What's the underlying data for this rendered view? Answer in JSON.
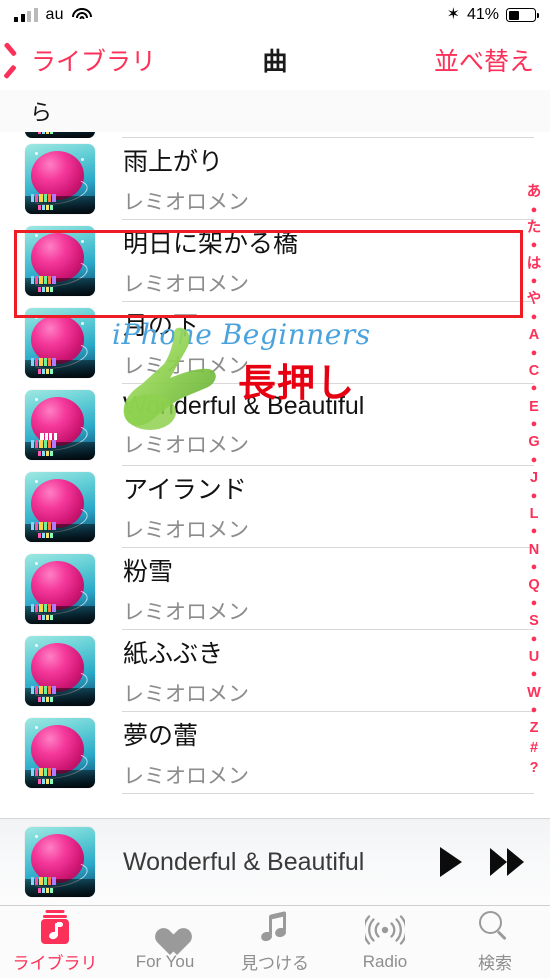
{
  "status_bar": {
    "carrier": "au",
    "signal_icon": "signal-bars-icon",
    "wifi_icon": "wifi-icon",
    "bluetooth_icon": "bluetooth-icon",
    "bluetooth_glyph": "✶",
    "battery_percent": "41%",
    "battery_level": 41
  },
  "nav_bar": {
    "back_label": "ライブラリ",
    "back_icon": "chevron-left-icon",
    "title": "曲",
    "sort_label": "並べ替え",
    "accent_color": "#fc3159"
  },
  "section_header": {
    "label": "ら"
  },
  "songs": [
    {
      "title": "雨上がり",
      "artist": "レミオロメン",
      "highlighted": false
    },
    {
      "title": "明日に架かる橋",
      "artist": "レミオロメン",
      "highlighted": true
    },
    {
      "title": "月の下",
      "artist": "レミオロメン",
      "highlighted": false
    },
    {
      "title": "Wonderful & Beautiful",
      "artist": "レミオロメン",
      "highlighted": false
    },
    {
      "title": "アイランド",
      "artist": "レミオロメン",
      "highlighted": false
    },
    {
      "title": "粉雪",
      "artist": "レミオロメン",
      "highlighted": false
    },
    {
      "title": "紙ふぶき",
      "artist": "レミオロメン",
      "highlighted": false
    },
    {
      "title": "夢の蕾",
      "artist": "レミオロメン",
      "highlighted": false
    }
  ],
  "index_bar": {
    "entries": [
      "あ",
      "●",
      "た",
      "●",
      "は",
      "●",
      "や",
      "●",
      "A",
      "●",
      "C",
      "●",
      "E",
      "●",
      "G",
      "●",
      "J",
      "●",
      "L",
      "●",
      "N",
      "●",
      "Q",
      "●",
      "S",
      "●",
      "U",
      "●",
      "W",
      "●",
      "Z",
      "#",
      "?"
    ],
    "color": "#fc3159"
  },
  "annotations": {
    "long_press_label": "長押し",
    "long_press_color": "#e60012",
    "highlight_box_color": "#ee1c25",
    "watermark": "iPhone Beginners",
    "watermark_color": "#4aa3dd",
    "hand_icon": "pointing-hand-icon"
  },
  "mini_player": {
    "now_playing_title": "Wonderful & Beautiful",
    "play_icon": "play-icon",
    "next_icon": "fast-forward-icon"
  },
  "tab_bar": {
    "items": [
      {
        "label": "ライブラリ",
        "icon": "library-icon",
        "active": true
      },
      {
        "label": "For You",
        "icon": "heart-icon",
        "active": false
      },
      {
        "label": "見つける",
        "icon": "music-note-icon",
        "active": false
      },
      {
        "label": "Radio",
        "icon": "radio-waves-icon",
        "active": false
      },
      {
        "label": "検索",
        "icon": "search-icon",
        "active": false
      }
    ],
    "active_color": "#fc3159",
    "inactive_color": "#8e8e8e"
  }
}
